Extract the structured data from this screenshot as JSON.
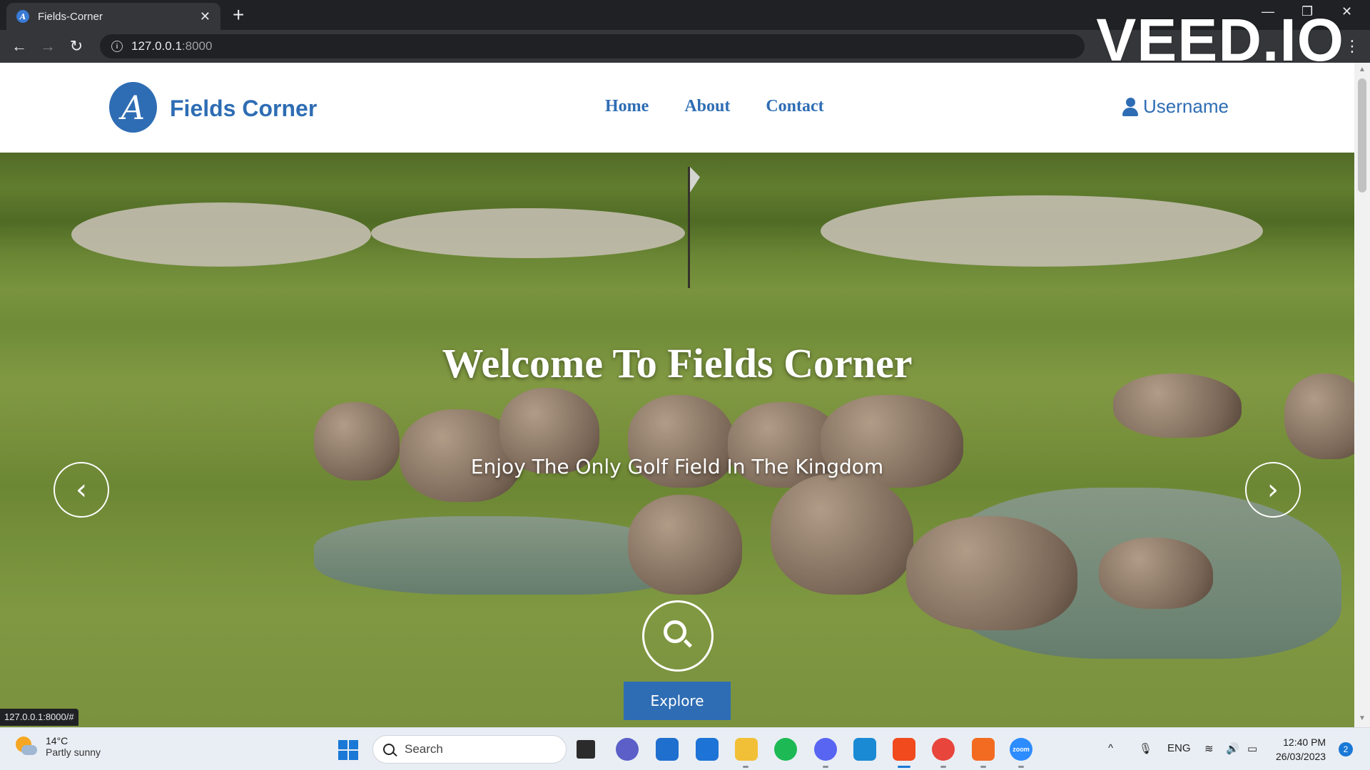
{
  "browser": {
    "tab_title": "Fields-Corner",
    "tab_close": "✕",
    "new_tab": "+",
    "url_host": "127.0.0.1",
    "url_port": ":8000",
    "status_url": "127.0.0.1:8000/#"
  },
  "watermark": "VEED.IO",
  "site": {
    "logo_letter": "A",
    "logo_text": "Fields Corner",
    "nav": [
      "Home",
      "About",
      "Contact"
    ],
    "username": "Username"
  },
  "hero": {
    "title": "Welcome To Fields Corner",
    "subtitle": "Enjoy The Only Golf Field In The Kingdom",
    "explore_label": "Explore",
    "prev_icon": "‹",
    "next_icon": "›"
  },
  "taskbar": {
    "weather_temp": "14°C",
    "weather_cond": "Partly sunny",
    "search_placeholder": "Search",
    "language": "ENG",
    "time": "12:40 PM",
    "date": "26/03/2023",
    "notifications": "2"
  },
  "colors": {
    "brand_blue": "#2e6db4",
    "grass": "#8aa645"
  },
  "icons": [
    "info-icon",
    "user-icon",
    "search-icon",
    "chevron-left-icon",
    "chevron-right-icon",
    "windows-start-icon",
    "weather-icon"
  ]
}
